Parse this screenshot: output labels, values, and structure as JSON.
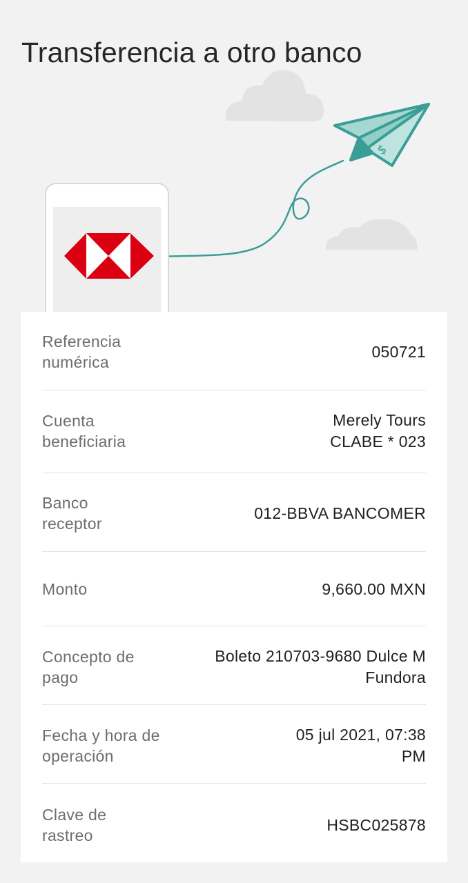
{
  "header": {
    "title": "Transferencia a otro banco"
  },
  "illustration": {
    "bank_logo": "HSBC",
    "icons": [
      "paper-plane-icon",
      "cloud-icon",
      "phone-icon",
      "dollar-icon"
    ],
    "colors": {
      "plane": "#3a9d96",
      "plane_fill": "#a6d8d2",
      "logo_red": "#db0011",
      "cloud": "#e3e3e3"
    }
  },
  "details": [
    {
      "label": "Referencia\nnumérica",
      "value": "050721"
    },
    {
      "label": "Cuenta\nbeneficiaria",
      "value": "Merely Tours\nCLABE * 023"
    },
    {
      "label": "Banco\nreceptor",
      "value": "012-BBVA BANCOMER"
    },
    {
      "label": "Monto",
      "value": "9,660.00 MXN"
    },
    {
      "label": "Concepto de\npago",
      "value": "Boleto 210703-9680 Dulce M\nFundora"
    },
    {
      "label": "Fecha y hora de\noperación",
      "value": "05 jul 2021, 07:38\nPM"
    },
    {
      "label": "Clave de\nrastreo",
      "value": "HSBC025878"
    }
  ]
}
